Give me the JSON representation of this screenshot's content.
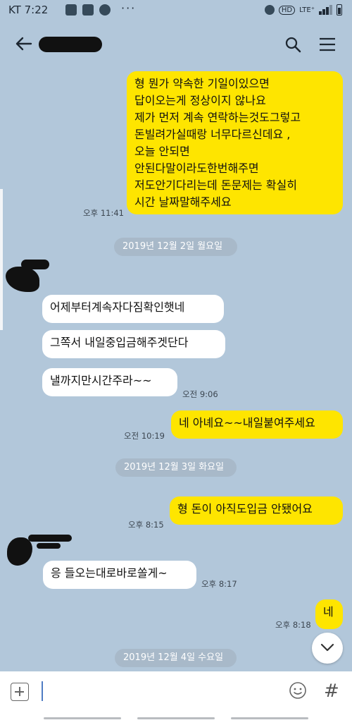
{
  "status_bar": {
    "time": "KT 7:22",
    "dots": "···",
    "network": "HD",
    "network_type": "LTE⁺"
  },
  "app_bar": {
    "title": "",
    "back_icon": "back-arrow-icon",
    "search_icon": "search-icon",
    "menu_icon": "menu-icon"
  },
  "messages": [
    {
      "sender": "me",
      "text": "형 뭔가 약속한 기일이있으면\n답이오는게 정상이지 않나요\n제가 먼저 계속 연락하는것도그렇고\n돈빌려가실때랑 너무다르신데요 ,\n오늘 안되면\n안된다말이라도한번해주면\n저도안기다리는데 돈문제는 확실히\n시간 날짜말해주세요",
      "time": "오후 11:41"
    },
    {
      "sender": "other",
      "text": "어제부터계속자다짐확인햇네",
      "time": ""
    },
    {
      "sender": "other",
      "text": "그쪽서 내일중입금해주겟단다",
      "time": ""
    },
    {
      "sender": "other",
      "text": "낼까지만시간주라~~",
      "time": "오전 9:06"
    },
    {
      "sender": "me",
      "text": "네 아녜요~~내일붙여주세요",
      "time": "오전 10:19"
    },
    {
      "sender": "me",
      "text": "형 돈이 아직도입금 안됐어요",
      "time": "오후 8:15"
    },
    {
      "sender": "other",
      "text": "응 들오는대로바로쏠게~",
      "time": "오후 8:17"
    },
    {
      "sender": "me",
      "text": "네",
      "time": "오후 8:18"
    }
  ],
  "date_dividers": [
    "2019년 12월 2일 월요일",
    "2019년 12월 3일 화요일",
    "2019년 12월 4일 수요일"
  ],
  "input_bar": {
    "placeholder": "",
    "plus_icon": "plus-icon",
    "emoji_icon": "emoji-icon",
    "hash_label": "#"
  },
  "colors": {
    "background": "#b2c7da",
    "my_bubble": "#fee500",
    "other_bubble": "#ffffff",
    "date_pill": "#a8b9c9"
  }
}
